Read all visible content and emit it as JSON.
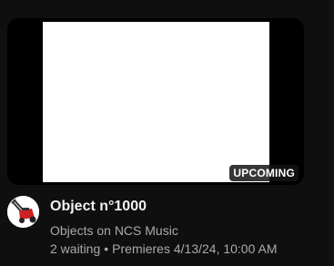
{
  "video": {
    "badge": "UPCOMING",
    "title": "Object n°1000",
    "channel": "Objects on NCS Music",
    "waiting": "2 waiting",
    "separator": "•",
    "premiere": "Premieres 4/13/24, 10:00 AM"
  },
  "colors": {
    "background": "#0f0f0f",
    "thumbnail_frame": "#000000",
    "thumbnail_image": "#ffffff",
    "title_text": "#f1f1f1",
    "secondary_text": "#aaaaaa",
    "avatar_accent": "#cc2222"
  },
  "icons": {
    "avatar": "lawn-mower-icon"
  }
}
